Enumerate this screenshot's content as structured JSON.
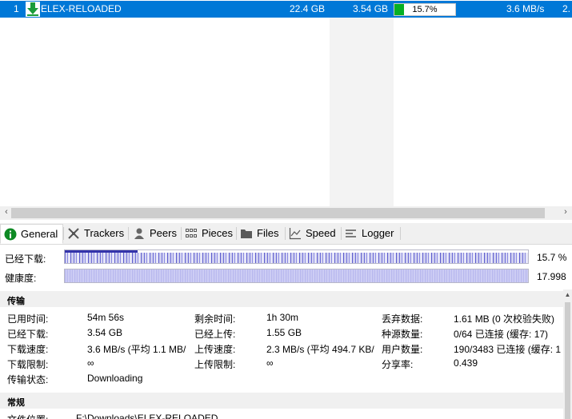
{
  "torrent_row": {
    "index": "1",
    "name": "ELEX-RELOADED",
    "size": "22.4 GB",
    "done": "3.54 GB",
    "progress_text": "15.7%",
    "progress_fraction": 0.157,
    "down_speed": "3.6 MB/s",
    "next_col": "2."
  },
  "tabs": [
    {
      "label": "General",
      "icon": "info-icon"
    },
    {
      "label": "Trackers",
      "icon": "trackers-icon"
    },
    {
      "label": "Peers",
      "icon": "peers-icon"
    },
    {
      "label": "Pieces",
      "icon": "pieces-icon"
    },
    {
      "label": "Files",
      "icon": "folder-icon"
    },
    {
      "label": "Speed",
      "icon": "speed-chart-icon"
    },
    {
      "label": "Logger",
      "icon": "logger-icon"
    }
  ],
  "bars": {
    "downloaded_label": "已经下载:",
    "downloaded_value": "15.7 %",
    "downloaded_fraction": 0.157,
    "health_label": "健康度:",
    "health_value": "17.998"
  },
  "transfer": {
    "heading": "传输",
    "elapsed_label": "已用时间:",
    "elapsed": "54m 56s",
    "remaining_label": "剩余时间:",
    "remaining": "1h 30m",
    "wasted_label": "丢弃数据:",
    "wasted": "1.61 MB (0 次校验失败)",
    "downloaded_label": "已经下载:",
    "downloaded": "3.54 GB",
    "uploaded_label": "已经上传:",
    "uploaded": "1.55 GB",
    "seeds_label": "种源数量:",
    "seeds": "0/64 已连接 (缓存: 17)",
    "dl_speed_label": "下载速度:",
    "dl_speed": "3.6 MB/s (平均 1.1 MB/",
    "ul_speed_label": "上传速度:",
    "ul_speed": "2.3 MB/s (平均 494.7 KB/",
    "peers_label": "用户数量:",
    "peers": "190/3483 已连接 (缓存: 1",
    "dl_limit_label": "下载限制:",
    "dl_limit": "∞",
    "ul_limit_label": "上传限制:",
    "ul_limit": "∞",
    "ratio_label": "分享率:",
    "ratio": "0.439",
    "status_label": "传输状态:",
    "status": "Downloading"
  },
  "general": {
    "heading": "常规",
    "location_label": "文件位置:",
    "location": "F:\\Downloads\\ELEX-RELOADED"
  },
  "colors": {
    "selection": "#0078d7",
    "progress_fill": "#06b025",
    "pieces": "#3333aa"
  }
}
